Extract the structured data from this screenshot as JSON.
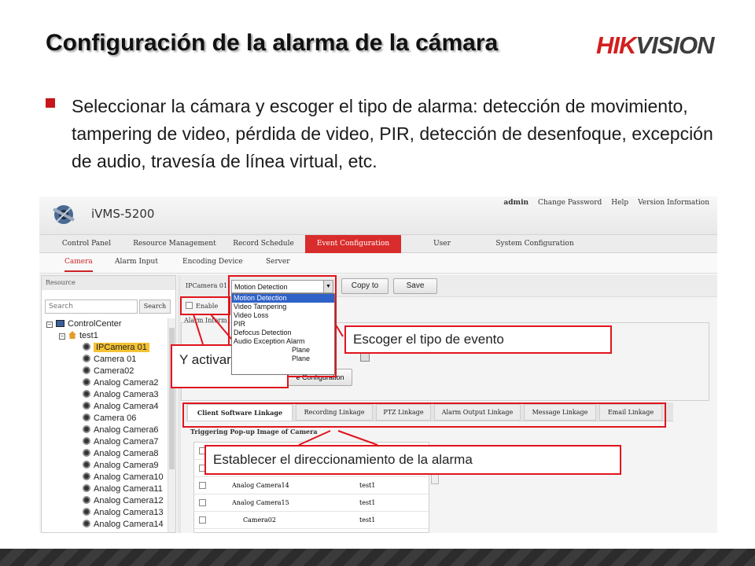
{
  "slide": {
    "title": "Configuración de la alarma de la cámara",
    "logo_hi": "HIK",
    "logo_rest": "VISION",
    "bullet": "Seleccionar la cámara y escoger el tipo de alarma: detección de movimiento, tampering de video, pérdida de video, PIR, detección de desenfoque, excepción de audio, travesía de línea virtual, etc."
  },
  "app": {
    "name": "iVMS-5200",
    "top_links": [
      "admin",
      "Change Password",
      "Help",
      "Version Information"
    ],
    "main_tabs": [
      {
        "label": "Control Panel",
        "active": false
      },
      {
        "label": "Resource Management",
        "active": false
      },
      {
        "label": "Record Schedule",
        "active": false
      },
      {
        "label": "Event Configuration",
        "active": true
      },
      {
        "label": "User Management",
        "active": false
      },
      {
        "label": "System Configuration",
        "active": false
      }
    ],
    "sub_tabs": [
      {
        "label": "Camera",
        "active": true
      },
      {
        "label": "Alarm Input",
        "active": false
      },
      {
        "label": "Encoding Device",
        "active": false
      },
      {
        "label": "Server",
        "active": false
      }
    ]
  },
  "resource_panel": {
    "header": "Resource",
    "search_placeholder": "Search",
    "search_button": "Search",
    "tree": [
      {
        "label": "ControlCenter",
        "kind": "root"
      },
      {
        "label": "test1",
        "kind": "group"
      },
      {
        "label": "IPCamera 01",
        "kind": "camera",
        "selected": true
      },
      {
        "label": "Camera 01",
        "kind": "camera"
      },
      {
        "label": "Camera02",
        "kind": "camera"
      },
      {
        "label": "Analog Camera2",
        "kind": "camera"
      },
      {
        "label": "Analog Camera3",
        "kind": "camera"
      },
      {
        "label": "Analog Camera4",
        "kind": "camera"
      },
      {
        "label": "Camera 06",
        "kind": "camera"
      },
      {
        "label": "Analog Camera6",
        "kind": "camera"
      },
      {
        "label": "Analog Camera7",
        "kind": "camera"
      },
      {
        "label": "Analog Camera8",
        "kind": "camera"
      },
      {
        "label": "Analog Camera9",
        "kind": "camera"
      },
      {
        "label": "Analog Camera10",
        "kind": "camera"
      },
      {
        "label": "Analog Camera11",
        "kind": "camera"
      },
      {
        "label": "Analog Camera12",
        "kind": "camera"
      },
      {
        "label": "Analog Camera13",
        "kind": "camera"
      },
      {
        "label": "Analog Camera14",
        "kind": "camera"
      }
    ]
  },
  "event_config": {
    "camera_label": "IPCamera 01",
    "selected_event": "Motion Detection",
    "copy_to": "Copy to",
    "save": "Save",
    "event_options": [
      "Motion Detection",
      "Video Tampering",
      "Video Loss",
      "PIR",
      "Defocus Detection",
      "Audio Exception Alarm",
      "Plane",
      "Plane"
    ],
    "enable_label": "Enable",
    "alarm_info_label": "Alarm Inform",
    "copy_config": "e Configuration",
    "linkage_tabs": [
      {
        "label": "Client Software Linkage",
        "active": true
      },
      {
        "label": "Recording Linkage",
        "active": false
      },
      {
        "label": "PTZ Linkage",
        "active": false
      },
      {
        "label": "Alarm Output Linkage",
        "active": false
      },
      {
        "label": "Message Linkage",
        "active": false
      },
      {
        "label": "Email Linkage",
        "active": false
      }
    ],
    "popup_label": "Triggering Pop-up Image of Camera",
    "table_rows": [
      {
        "name": "Analog Camera14",
        "group": "test1"
      },
      {
        "name": "Analog Camera15",
        "group": "test1"
      },
      {
        "name": "Camera02",
        "group": "test1"
      }
    ]
  },
  "annotations": {
    "event_type": "Escoger el tipo de evento",
    "activate": "Y activarlo",
    "routing": "Establecer el direccionamiento de la alarma"
  },
  "colors": {
    "accent_red": "#e0141d",
    "active_tab": "#d92c2c",
    "selection_blue": "#2f62c9"
  }
}
